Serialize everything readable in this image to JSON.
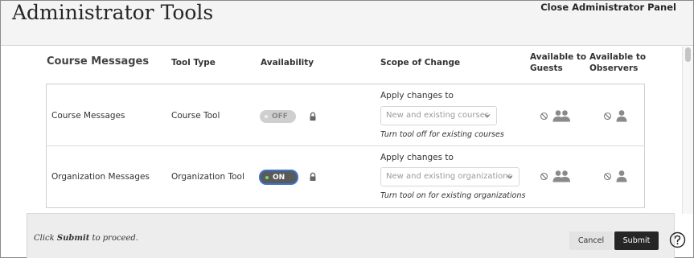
{
  "header": {
    "title": "Administrator Tools",
    "close_label": "Close Administrator Panel"
  },
  "table": {
    "section_title": "Course Messages",
    "columns": {
      "tool_type": "Tool Type",
      "availability": "Availability",
      "scope": "Scope of Change",
      "guests_line1": "Available to",
      "guests_line2": "Guests",
      "observers_line1": "Available to",
      "observers_line2": "Observers"
    },
    "rows": [
      {
        "name": "Course Messages",
        "tool_type": "Course Tool",
        "availability": "OFF",
        "apply_label": "Apply changes to",
        "scope_value": "New and existing courses",
        "note": "Turn tool off for existing courses",
        "guests_icon": "not-available-icon",
        "observers_icon": "not-available-icon"
      },
      {
        "name": "Organization Messages",
        "tool_type": "Organization Tool",
        "availability": "ON",
        "apply_label": "Apply changes to",
        "scope_value": "New and existing organizations",
        "note": "Turn tool on for existing organizations",
        "guests_icon": "not-available-icon",
        "observers_icon": "not-available-icon"
      }
    ]
  },
  "footer": {
    "hint_prefix": "Click ",
    "hint_bold": "Submit",
    "hint_suffix": " to proceed.",
    "cancel_label": "Cancel",
    "submit_label": "Submit"
  },
  "colors": {
    "toggle_on_bg": "#5a5a5a",
    "toggle_on_border": "#3b73d1",
    "toggle_on_dot": "#7cd46e",
    "toggle_off_bg": "#cfcfcf",
    "submit_bg": "#262626"
  }
}
